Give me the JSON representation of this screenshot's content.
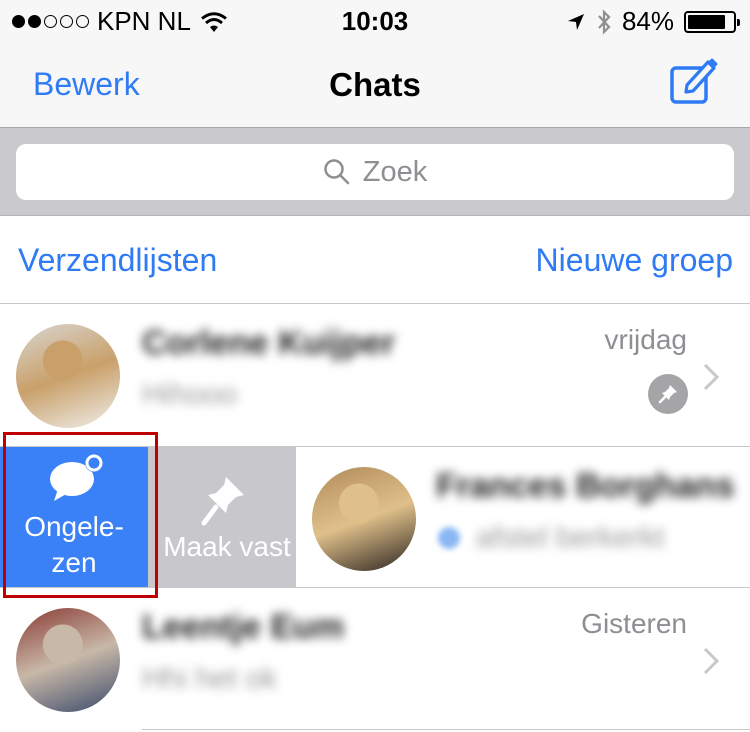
{
  "status_bar": {
    "signal_bars_filled": 2,
    "signal_bars_total": 5,
    "carrier": "KPN NL",
    "time": "10:03",
    "battery_percent": "84%",
    "battery_level": 0.84,
    "icons": [
      "wifi-icon",
      "location-arrow-icon",
      "bluetooth-icon",
      "battery-icon"
    ]
  },
  "nav": {
    "edit_label": "Bewerk",
    "title": "Chats",
    "compose_icon": "compose-icon"
  },
  "search": {
    "placeholder": "Zoek",
    "icon": "search-icon"
  },
  "links": {
    "broadcast_lists": "Verzendlijsten",
    "new_group": "Nieuwe groep"
  },
  "chats": [
    {
      "name": "Corlene Kuijper",
      "message": "Hihooo",
      "date": "vrijdag",
      "pinned": true,
      "avatar_colors": [
        "#d9d6d2",
        "#c9a06a",
        "#f0efec"
      ]
    },
    {
      "name": "Frances Borghans",
      "message": "afstel berkerkt",
      "date": "",
      "read_tick": true,
      "swiped": true,
      "avatar_colors": [
        "#b08a5a",
        "#e0c08a",
        "#2a2420"
      ],
      "actions": [
        {
          "label": "Ongele-\nzen",
          "label_line1": "Ongele-",
          "label_line2": "zen",
          "icon": "unread-chat-icon",
          "color": "#3a80f6"
        },
        {
          "label": "Maak vast",
          "icon": "pin-icon",
          "color": "#c7c7cc"
        }
      ]
    },
    {
      "name": "Leentje Eum",
      "message": "Hhi het ok",
      "date": "Gisteren",
      "pinned": false,
      "avatar_colors": [
        "#8a3a34",
        "#c8b8a8",
        "#3a4a6a"
      ]
    }
  ]
}
